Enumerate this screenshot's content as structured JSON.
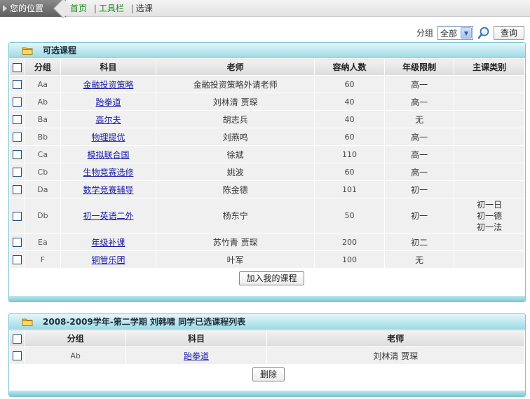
{
  "breadcrumb": {
    "location_label": "您的位置",
    "home": "首页",
    "toolbar": "工具栏",
    "current": "选课"
  },
  "filter": {
    "label": "分组",
    "selected": "全部",
    "query_button": "查询"
  },
  "available_panel": {
    "title": "可选课程",
    "columns": [
      "分组",
      "科目",
      "老师",
      "容纳人数",
      "年级限制",
      "主课类别"
    ],
    "rows": [
      {
        "group": "Aa",
        "subject": "金融投资策略",
        "teacher": "金融投资策略外请老师",
        "capacity": "60",
        "grade": "高一",
        "main": ""
      },
      {
        "group": "Ab",
        "subject": "跆拳道",
        "teacher": "刘林清  贾琛",
        "capacity": "40",
        "grade": "高一",
        "main": ""
      },
      {
        "group": "Ba",
        "subject": "高尔夫",
        "teacher": "胡志兵",
        "capacity": "40",
        "grade": "无",
        "main": ""
      },
      {
        "group": "Bb",
        "subject": "物理提优",
        "teacher": "刘燕鸣",
        "capacity": "60",
        "grade": "高一",
        "main": ""
      },
      {
        "group": "Ca",
        "subject": "模拟联合国",
        "teacher": "徐斌",
        "capacity": "110",
        "grade": "高一",
        "main": ""
      },
      {
        "group": "Cb",
        "subject": "生物竞赛选修",
        "teacher": "姚波",
        "capacity": "60",
        "grade": "高一",
        "main": ""
      },
      {
        "group": "Da",
        "subject": "数学竞赛辅导",
        "teacher": "陈金德",
        "capacity": "101",
        "grade": "初一",
        "main": ""
      },
      {
        "group": "Db",
        "subject": "初一英语二外",
        "teacher": "杨东宁",
        "capacity": "50",
        "grade": "初一",
        "main": [
          "初一日",
          "初一德",
          "初一法"
        ]
      },
      {
        "group": "Ea",
        "subject": "年级补课",
        "teacher": "苏竹青  贾琛",
        "capacity": "200",
        "grade": "初二",
        "main": ""
      },
      {
        "group": "F",
        "subject": "铜管乐团",
        "teacher": "叶军",
        "capacity": "100",
        "grade": "无",
        "main": ""
      }
    ],
    "add_button": "加入我的课程"
  },
  "selected_panel": {
    "title": "2008-2009学年-第二学期  刘韩啸  同学已选课程列表",
    "columns": [
      "分组",
      "科目",
      "老师"
    ],
    "rows": [
      {
        "group": "Ab",
        "subject": "跆拳道",
        "teacher": "刘林清  贾琛"
      }
    ],
    "delete_button": "删除"
  }
}
